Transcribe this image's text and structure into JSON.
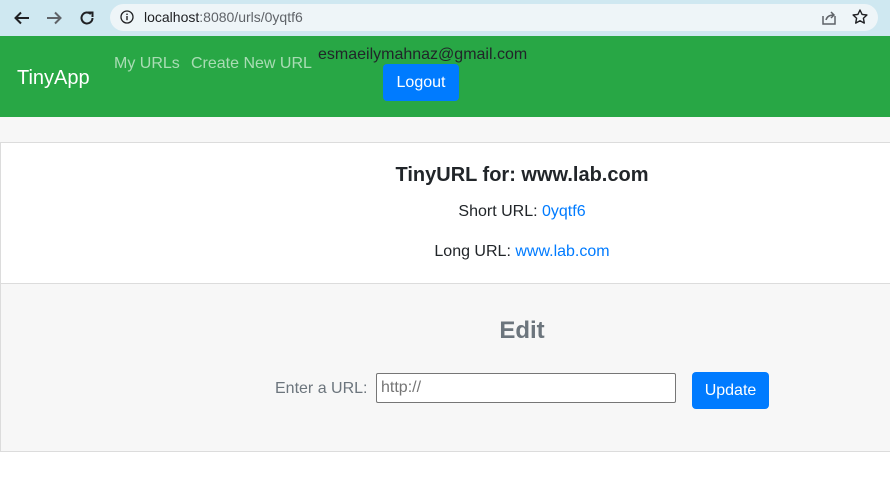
{
  "browser": {
    "url_host": "localhost",
    "url_path": ":8080/urls/0yqtf6"
  },
  "navbar": {
    "brand": "TinyApp",
    "links": [
      "My URLs",
      "Create New URL"
    ],
    "user_email": "esmaeilymahnaz@gmail.com",
    "logout_label": "Logout",
    "color": "#28a745"
  },
  "url_card": {
    "title": "TinyURL for: www.lab.com",
    "short_url_label": "Short URL:",
    "short_url_value": "0yqtf6",
    "long_url_label": "Long URL:",
    "long_url_value": "www.lab.com",
    "link_color": "#007bff"
  },
  "edit": {
    "title": "Edit",
    "input_label": "Enter a URL:",
    "input_placeholder": "http://",
    "input_value": "",
    "update_label": "Update"
  }
}
